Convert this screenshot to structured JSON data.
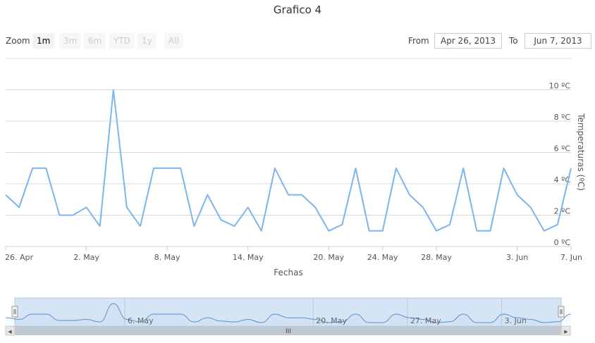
{
  "chart_data": {
    "type": "line",
    "title": "Grafico 4",
    "xlabel": "Fechas",
    "ylabel": "Temperaturas (ºC)",
    "x_tick_labels": [
      "26. Apr",
      "2. May",
      "8. May",
      "14. May",
      "20. May",
      "24. May",
      "28. May",
      "3. Jun",
      "7. Jun"
    ],
    "y_tick_labels": [
      "0 ºC",
      "2 ºC",
      "4 ºC",
      "6 ºC",
      "8 ºC",
      "10 ºC"
    ],
    "ylim": [
      0,
      12
    ],
    "grid": true,
    "series": [
      {
        "x": [
          "2013-04-26",
          "2013-04-27",
          "2013-04-28",
          "2013-04-29",
          "2013-04-30",
          "2013-05-01",
          "2013-05-02",
          "2013-05-03",
          "2013-05-04",
          "2013-05-05",
          "2013-05-06",
          "2013-05-07",
          "2013-05-08",
          "2013-05-09",
          "2013-05-10",
          "2013-05-11",
          "2013-05-12",
          "2013-05-13",
          "2013-05-14",
          "2013-05-15",
          "2013-05-16",
          "2013-05-17",
          "2013-05-18",
          "2013-05-19",
          "2013-05-20",
          "2013-05-21",
          "2013-05-22",
          "2013-05-23",
          "2013-05-24",
          "2013-05-25",
          "2013-05-26",
          "2013-05-27",
          "2013-05-28",
          "2013-05-29",
          "2013-05-30",
          "2013-05-31",
          "2013-06-01",
          "2013-06-02",
          "2013-06-03",
          "2013-06-04",
          "2013-06-05",
          "2013-06-06",
          "2013-06-07"
        ],
        "values": [
          3.3,
          2.5,
          5.0,
          5.0,
          2.0,
          2.0,
          2.5,
          1.3,
          10.0,
          2.5,
          1.3,
          5.0,
          5.0,
          5.0,
          1.3,
          3.3,
          1.7,
          1.3,
          2.5,
          1.0,
          5.0,
          3.3,
          3.3,
          2.5,
          1.0,
          1.4,
          5.0,
          1.0,
          1.0,
          5.0,
          3.3,
          2.5,
          1.0,
          1.4,
          5.0,
          1.0,
          1.0,
          5.0,
          3.3,
          2.5,
          1.0,
          1.4,
          5.0
        ],
        "color": "#7cb5ec"
      }
    ],
    "navigator": {
      "tick_labels": [
        "6. May",
        "20. May",
        "27. May",
        "3. Jun"
      ]
    }
  },
  "header": {
    "zoom_label": "Zoom",
    "zoom_buttons": [
      "1m",
      "3m",
      "6m",
      "YTD",
      "1y",
      "All"
    ],
    "from_label": "From",
    "from_value": "Apr 26, 2013",
    "to_label": "To",
    "to_value": "Jun 7, 2013"
  },
  "scrollbar": {
    "grip_glyph": "III",
    "left_arrow_glyph": "◀",
    "right_arrow_glyph": "▶"
  }
}
